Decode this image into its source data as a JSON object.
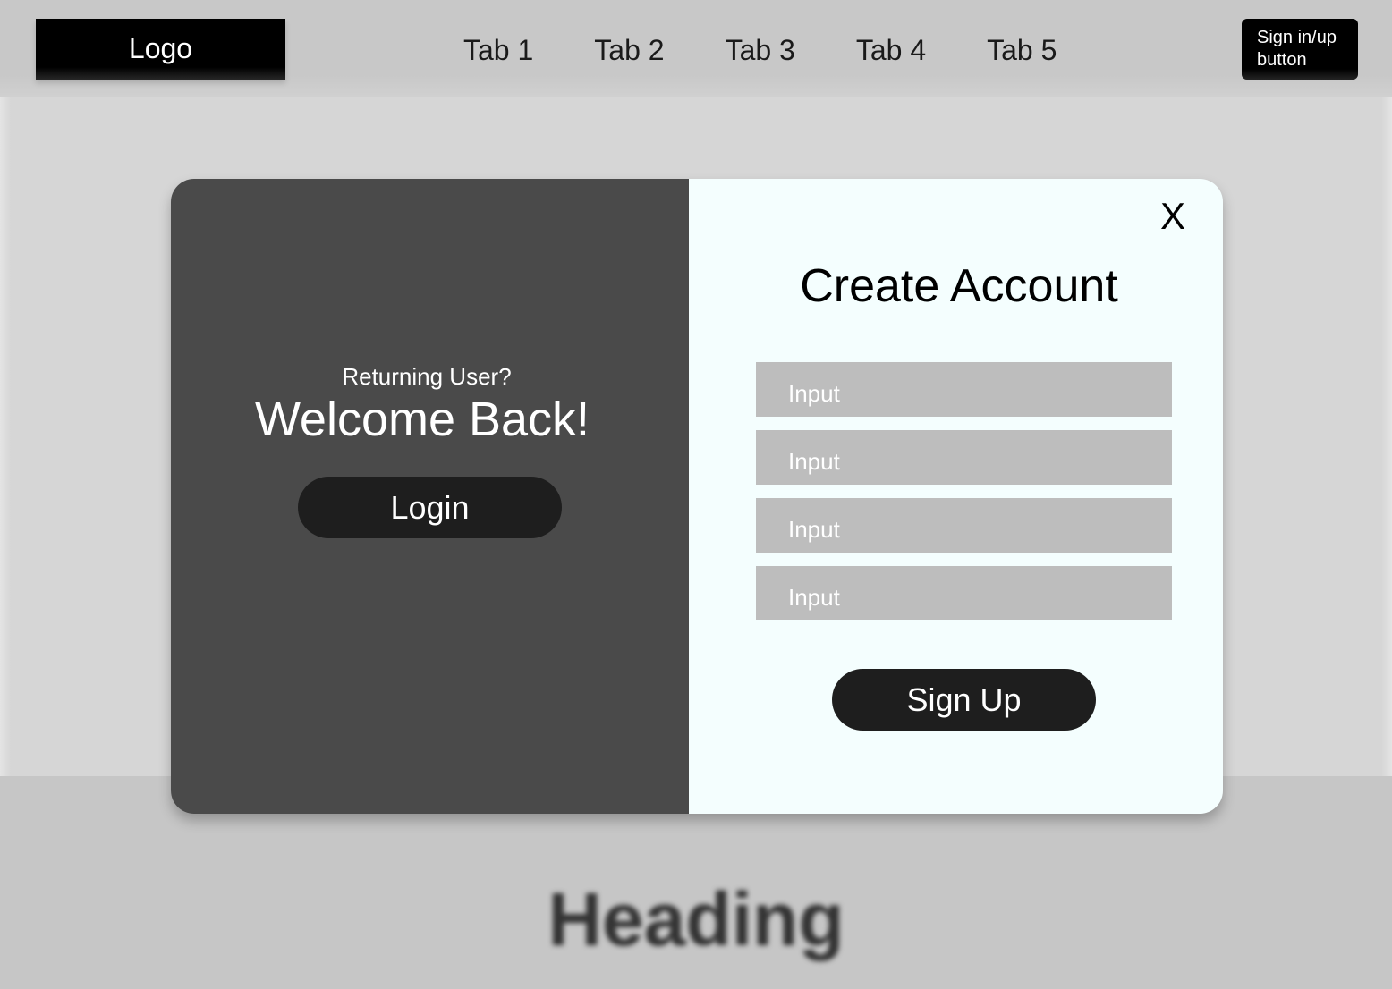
{
  "header": {
    "logo": "Logo",
    "tabs": [
      {
        "label": "Tab 1"
      },
      {
        "label": "Tab 2"
      },
      {
        "label": "Tab 3"
      },
      {
        "label": "Tab 4"
      },
      {
        "label": "Tab 5"
      }
    ],
    "signin_line1": "Sign in/up",
    "signin_line2": "button"
  },
  "background": {
    "heading": "Heading"
  },
  "modal": {
    "left": {
      "subtitle": "Returning User?",
      "title": "Welcome Back!",
      "login_label": "Login"
    },
    "right": {
      "close_label": "X",
      "title": "Create Account",
      "inputs": [
        {
          "placeholder": "Input"
        },
        {
          "placeholder": "Input"
        },
        {
          "placeholder": "Input"
        },
        {
          "placeholder": "Input"
        }
      ],
      "signup_label": "Sign Up"
    }
  },
  "colors": {
    "modal_left_bg": "#4a4a4a",
    "modal_right_bg": "#f4fefe",
    "button_bg": "#1e1e1e",
    "input_bg": "#bdbdbd"
  }
}
